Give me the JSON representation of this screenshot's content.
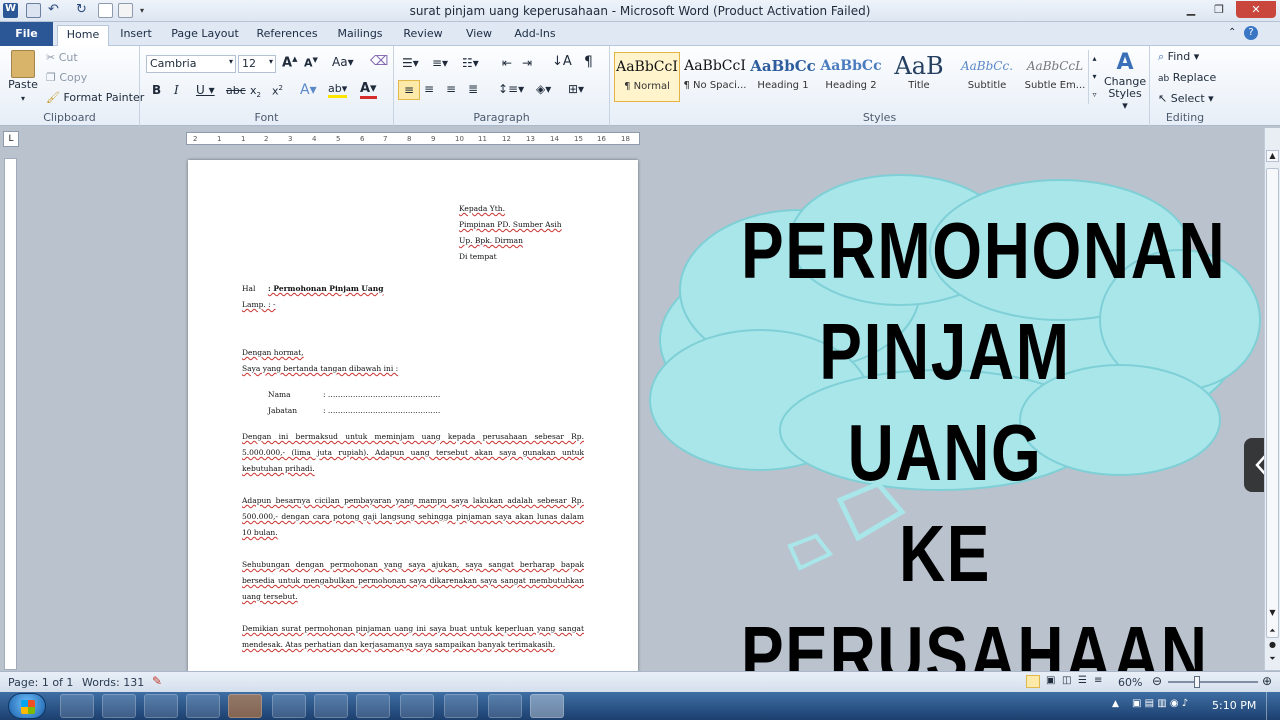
{
  "window": {
    "title": "surat pinjam uang keperusahaan  -  Microsoft Word (Product Activation Failed)",
    "app_icon": "word-icon"
  },
  "tabs": [
    "File",
    "Home",
    "Insert",
    "Page Layout",
    "References",
    "Mailings",
    "Review",
    "View",
    "Add-Ins"
  ],
  "ribbon": {
    "clipboard": {
      "paste": "Paste",
      "cut": "Cut",
      "copy": "Copy",
      "format_painter": "Format Painter",
      "label": "Clipboard"
    },
    "font": {
      "family": "Cambria",
      "size": "12",
      "label": "Font"
    },
    "paragraph": {
      "label": "Paragraph"
    },
    "styles": {
      "items": [
        {
          "preview": "AaBbCcI",
          "name": "¶ Normal"
        },
        {
          "preview": "AaBbCcI",
          "name": "¶ No Spaci..."
        },
        {
          "preview": "AaBbCc",
          "name": "Heading 1"
        },
        {
          "preview": "AaBbCc",
          "name": "Heading 2"
        },
        {
          "preview": "AaB",
          "name": "Title"
        },
        {
          "preview": "AaBbCc.",
          "name": "Subtitle"
        },
        {
          "preview": "AaBbCcL",
          "name": "Subtle Em..."
        }
      ],
      "change_styles": "Change Styles",
      "label": "Styles"
    },
    "editing": {
      "find": "Find",
      "replace": "Replace",
      "select": "Select",
      "label": "Editing"
    }
  },
  "ruler": {
    "ticks": [
      "2",
      "1",
      "1",
      "2",
      "3",
      "4",
      "5",
      "6",
      "7",
      "8",
      "9",
      "10",
      "11",
      "12",
      "13",
      "14",
      "15",
      "16",
      "18"
    ]
  },
  "document": {
    "to": [
      "Kepada Yth.",
      "Pimpinan PD. Sumber Asih",
      "Up. Bpk. Dirman",
      "Di tempat"
    ],
    "hal_label": "Hal",
    "hal_value": ": Permohonan Pinjam Uang",
    "lamp": "Lamp.  : -",
    "greeting": "Dengan hormat,",
    "intro": "Saya yang bertanda tangan dibawah ini :",
    "fields": [
      {
        "label": "Nama",
        "value": ": ………………………………………"
      },
      {
        "label": "Jabatan",
        "value": ": ………………………………………"
      }
    ],
    "paragraphs": [
      "Dengan ini bermaksud untuk meminjam uang kepada perusahaan sebesar Rp. 5.000.000,- (lima juta rupiah). Adapun uang tersebut akan saya gunakan untuk kebutuhan prihadi.",
      "Adapun besarnya cicilan pembayaran yang mampu saya lakukan adalah sebesar Rp. 500.000,- dengan cara potong gaji langsung sehingga pinjaman saya akan lunas dalam 10 bulan.",
      "Sehubungan dengan permohonan yang saya ajukan, saya sangat berharap bapak bersedia untuk mengabulkan permohonan saya dikarenakan saya sangat membutuhkan uang tersebut.",
      "Demikian surat permohonan pinjaman uang ini saya buat untuk keperluan yang sangat mendesak. Atas perhatian dan kerjasamanya saya sampaikan banyak terimakasih."
    ]
  },
  "overlay": {
    "lines": [
      "PERMOHONAN",
      "PINJAM UANG",
      "KE PERUSAHAAN"
    ],
    "cloud_color": "#a8e6ea"
  },
  "status": {
    "page": "Page: 1 of 1",
    "words": "Words: 131",
    "zoom": "60%"
  },
  "taskbar": {
    "time": "5:10 PM"
  }
}
